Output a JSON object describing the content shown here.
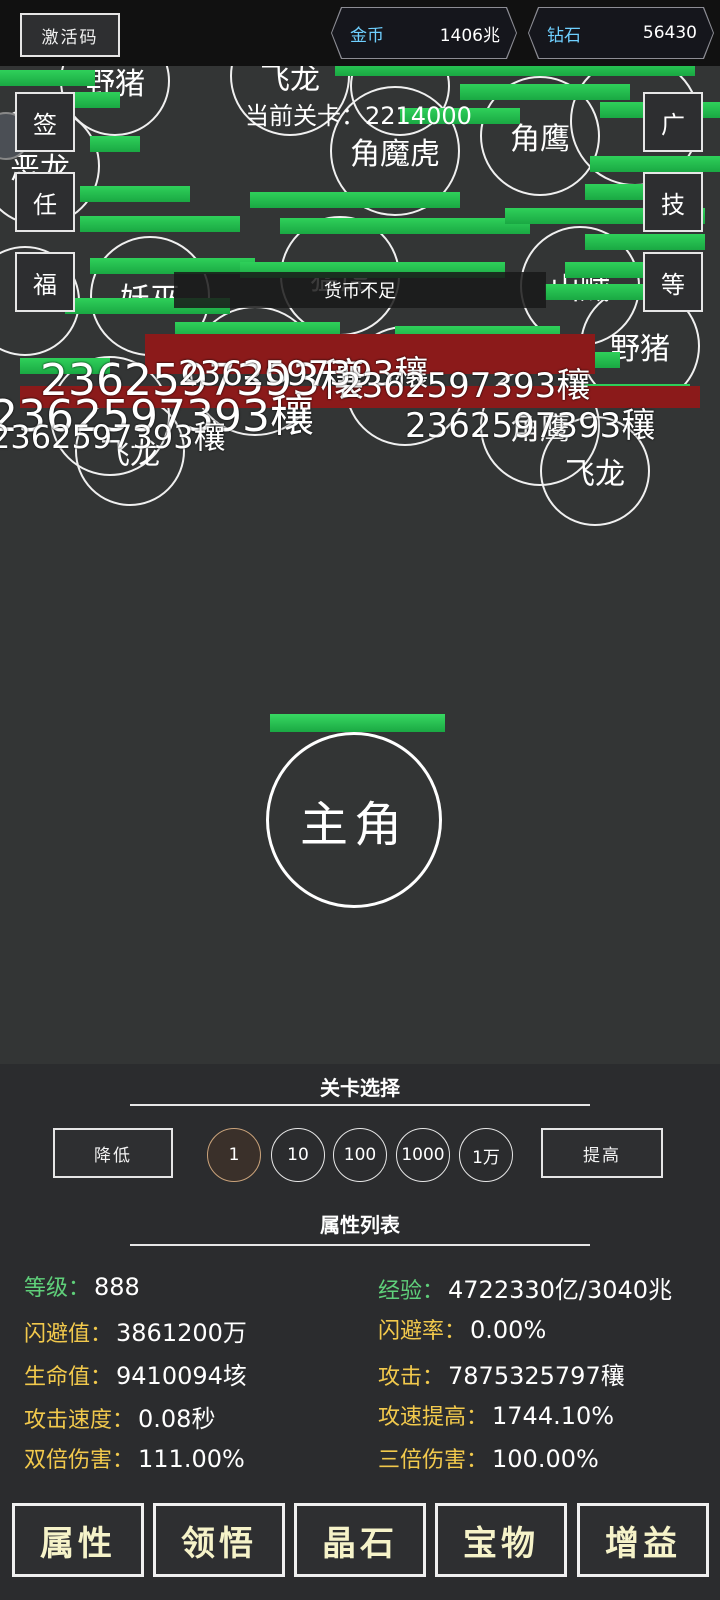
{
  "topbar": {
    "activation_code": "激活码",
    "gold_label": "金币",
    "gold_value": "1406兆",
    "diamond_label": "钻石",
    "diamond_value": "56430"
  },
  "side_buttons_left": [
    "签",
    "任",
    "福"
  ],
  "side_buttons_right": [
    "广",
    "技",
    "等"
  ],
  "battle": {
    "current_stage": "当前关卡：2214000",
    "toast": "货币不足",
    "damage_number": "2362597393穰",
    "hero_label": "主角",
    "enemy_names": [
      "恶龙",
      "野猪",
      "角鹰",
      "猛虎",
      "飞龙",
      "角魔虎",
      "妖巫",
      "山贼",
      "角鹰",
      "飞龙",
      "野猪",
      "角鹰",
      "飞龙"
    ]
  },
  "stage_select": {
    "title": "关卡选择",
    "decrease": "降低",
    "increase": "提高",
    "steps": [
      "1",
      "10",
      "100",
      "1000",
      "1万"
    ],
    "active_step": "1"
  },
  "attributes": {
    "title": "属性列表",
    "items": [
      {
        "label": "等级：",
        "value": "888",
        "color": "#5fd07a"
      },
      {
        "label": "经验：",
        "value": "4722330亿/3040兆",
        "color": "#5fd07a"
      },
      {
        "label": "闪避值：",
        "value": "3861200万",
        "color": "#f2c94c"
      },
      {
        "label": "闪避率：",
        "value": "0.00%",
        "color": "#f2c94c"
      },
      {
        "label": "生命值：",
        "value": "9410094垓",
        "color": "#f2c94c"
      },
      {
        "label": "攻击：",
        "value": "7875325797穰",
        "color": "#f2c94c"
      },
      {
        "label": "攻击速度：",
        "value": "0.08秒",
        "color": "#f2c94c"
      },
      {
        "label": "攻速提高：",
        "value": "1744.10%",
        "color": "#f2c94c"
      },
      {
        "label": "双倍伤害：",
        "value": "111.00%",
        "color": "#f2c94c"
      },
      {
        "label": "三倍伤害：",
        "value": "100.00%",
        "color": "#f2c94c"
      }
    ]
  },
  "bottom_tabs": [
    "属性",
    "领悟",
    "晶石",
    "宝物",
    "增益"
  ]
}
